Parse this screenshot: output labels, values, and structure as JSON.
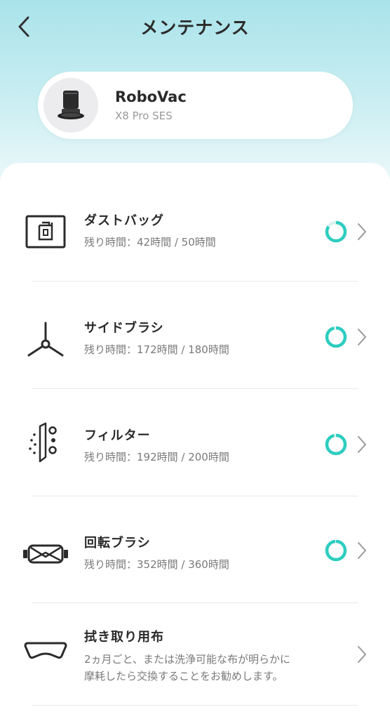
{
  "header": {
    "title": "メンテナンス"
  },
  "device": {
    "name": "RoboVac",
    "model": "X8 Pro SES"
  },
  "colors": {
    "accent": "#2ecdc0",
    "ring_track": "#d6f3f0"
  },
  "items": [
    {
      "title": "ダストバッグ",
      "remaining": "残り時間：42時間 / 50時間",
      "icon": "dust-bag-icon",
      "level": 0.84
    },
    {
      "title": "サイドブラシ",
      "remaining": "残り時間：172時間 / 180時間",
      "icon": "side-brush-icon",
      "level": 0.96
    },
    {
      "title": "フィルター",
      "remaining": "残り時間：192時間 / 200時間",
      "icon": "filter-icon",
      "level": 0.96
    },
    {
      "title": "回転ブラシ",
      "remaining": "残り時間：352時間 / 360時間",
      "icon": "rolling-brush-icon",
      "level": 0.98
    },
    {
      "title": "拭き取り用布",
      "desc_line1": "2ヵ月ごと、または洗浄可能な布が明らかに",
      "desc_line2": "摩耗したら交換することをお勧めします。",
      "icon": "mop-cloth-icon"
    }
  ]
}
